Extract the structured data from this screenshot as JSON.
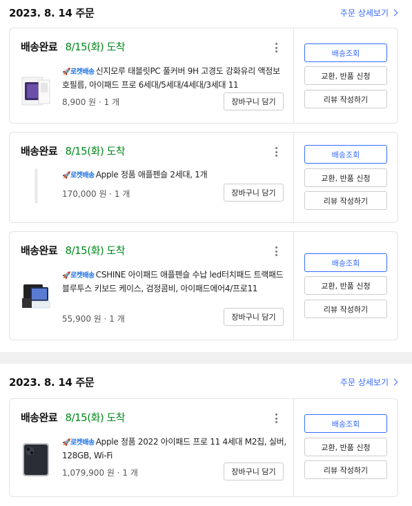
{
  "labels": {
    "detail_link": "주문 상세보기",
    "done": "배송완료",
    "dot": "·",
    "rocket": "🚀로켓배송",
    "cart": "장바구니 담기",
    "track": "배송조회",
    "exchange": "교환, 반품 신청",
    "review": "리뷰 작성하기"
  },
  "colors": {
    "accent": "#346aff",
    "arrive_green": "#00891a",
    "rocket_blue": "#1e74e6"
  },
  "orders": [
    {
      "date": "2023. 8. 14 주문",
      "items": [
        {
          "arrive": "8/15(화) 도착",
          "title": "신지모루 태블릿PC 풀커버 9H 고경도 강화유리 액정보호필름, 아이패드 프로 6세대/5세대/4세대/3세대 11",
          "price": "8,900 원 · 1 개",
          "thumb": "screen-protector-box"
        },
        {
          "arrive": "8/15(화) 도착",
          "title": "Apple 정품 애플펜슬 2세대, 1개",
          "price": "170,000 원 · 1 개",
          "thumb": "apple-pencil"
        },
        {
          "arrive": "8/15(화) 도착",
          "title": "CSHINE 아이패드 애플펜슬 수납 led터치패드 트랙패드 블루투스 키보드 케이스, 검정콤비, 아이패드에어4/프로11",
          "price": "55,900 원 · 1 개",
          "thumb": "keyboard-case"
        }
      ]
    },
    {
      "date": "2023. 8. 14 주문",
      "items": [
        {
          "arrive": "8/15(화) 도착",
          "title": "Apple 정품 2022 아이패드 프로 11 4세대 M2칩, 실버, 128GB, Wi-Fi",
          "price": "1,079,900 원 · 1 개",
          "thumb": "ipad-pro"
        }
      ]
    }
  ]
}
